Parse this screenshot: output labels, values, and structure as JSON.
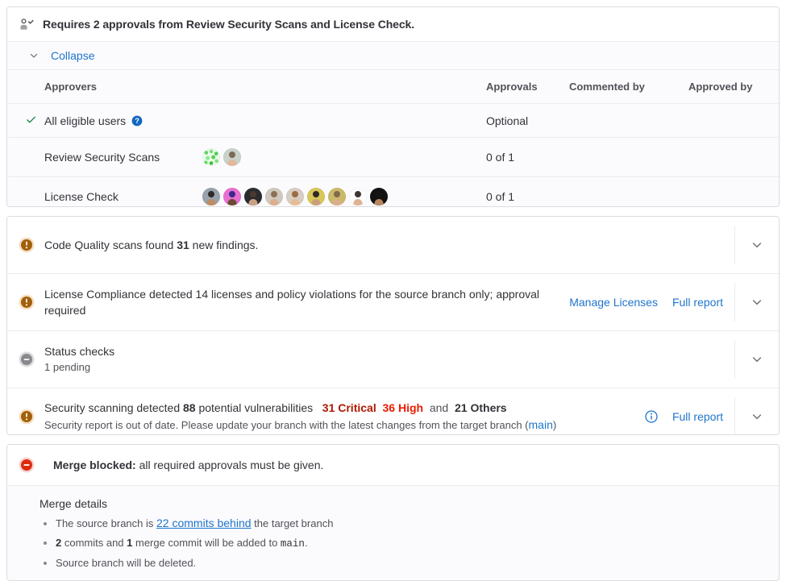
{
  "approvals": {
    "header_title": "Requires 2 approvals from Review Security Scans and License Check.",
    "header_icon": "approval-user-check-icon",
    "collapse_label": "Collapse",
    "columns": {
      "approvers": "Approvers",
      "approvals": "Approvals",
      "commented_by": "Commented by",
      "approved_by": "Approved by"
    },
    "rows": [
      {
        "name": "All eligible users",
        "has_check": true,
        "has_help": true,
        "approvals": "Optional",
        "commented_by": "",
        "approved_by": "",
        "avatars": []
      },
      {
        "name": "Review Security Scans",
        "has_check": false,
        "has_help": false,
        "approvals": "0 of 1",
        "commented_by": "",
        "approved_by": "",
        "avatars": [
          {
            "type": "identicon",
            "bg": "#ecfbec",
            "skin": "#8fd18f",
            "hair": "#4ec24e"
          },
          {
            "type": "photo",
            "bg": "#c8d2cb",
            "skin": "#e3b79a",
            "hair": "#7d6a53"
          }
        ]
      },
      {
        "name": "License Check",
        "has_check": false,
        "has_help": false,
        "approvals": "0 of 1",
        "commented_by": "",
        "approved_by": "",
        "avatars": [
          {
            "type": "photo",
            "bg": "#97a3ad",
            "skin": "#c08c63",
            "hair": "#2f2a28"
          },
          {
            "type": "photo",
            "bg": "#e86fd0",
            "skin": "#6b4a33",
            "hair": "#3b2a8c"
          },
          {
            "type": "photo",
            "bg": "#2b2b2f",
            "skin": "#caa184",
            "hair": "#4a3a2e"
          },
          {
            "type": "photo",
            "bg": "#cfc9c0",
            "skin": "#dcae8b",
            "hair": "#8c7154"
          },
          {
            "type": "photo",
            "bg": "#d8cdc4",
            "skin": "#e9bb94",
            "hair": "#9b6b43"
          },
          {
            "type": "photo",
            "bg": "#d8c758",
            "skin": "#caa07c",
            "hair": "#2e2b27"
          },
          {
            "type": "photo",
            "bg": "#cbb96a",
            "skin": "#dcae8b",
            "hair": "#7f6a4c"
          },
          {
            "type": "photo",
            "bg": "#fdfdfd",
            "skin": "#dfb392",
            "hair": "#3c3733"
          },
          {
            "type": "photo",
            "bg": "#121212",
            "skin": "#b8865f",
            "hair": "#171513"
          }
        ]
      }
    ]
  },
  "reports": [
    {
      "icon": "warning-icon",
      "icon_color": "#a35f0a",
      "text_before": "Code Quality scans found ",
      "text_bold": "31",
      "text_after": " new findings.",
      "subtext": "",
      "links": [],
      "toggle_icon": "chevron-down-icon"
    },
    {
      "icon": "warning-icon",
      "icon_color": "#a35f0a",
      "text_before": "License Compliance detected 14 licenses and policy violations for the source branch only; approval required",
      "text_bold": "",
      "text_after": "",
      "subtext": "",
      "links": [
        "Manage Licenses",
        "Full report"
      ],
      "toggle_icon": "chevron-down-icon"
    },
    {
      "icon": "pending-icon",
      "icon_color": "#89888d",
      "text_before": "Status checks",
      "text_bold": "",
      "text_after": "",
      "subtext": "1 pending",
      "links": [],
      "toggle_icon": "chevron-down-icon"
    },
    {
      "icon": "warning-icon",
      "icon_color": "#a35f0a",
      "text_before": "Security scanning detected ",
      "text_bold": "88",
      "text_after": " potential vulnerabilities",
      "severity_critical": "31 Critical",
      "severity_high": "36 High",
      "severity_and": "and",
      "severity_others": "21 Others",
      "subtext_before": "Security report is out of date. Please update your branch with the latest changes from the target branch (",
      "subtext_link": "main",
      "subtext_after": ")",
      "links": [
        "Full report"
      ],
      "info_icon": "info-circle-icon",
      "toggle_icon": "chevron-down-icon"
    }
  ],
  "merge_blocked": {
    "icon": "merge-blocked-icon",
    "title_bold": "Merge blocked:",
    "title_rest": " all required approvals must be given.",
    "details_title": "Merge details",
    "details": [
      {
        "before": "The source branch is ",
        "link": "22 commits behind",
        "after": " the target branch"
      },
      {
        "bold1": "2",
        "mid1": " commits and ",
        "bold2": "1",
        "mid2": " merge commit will be added to ",
        "code": "main",
        "tail": "."
      },
      {
        "plain": "Source branch will be deleted."
      }
    ]
  },
  "colors": {
    "link": "#1f75cb",
    "warning": "#a35f0a",
    "danger": "#dd2b0e",
    "critical": "#ae1800",
    "high": "#ec1b00",
    "pending": "#89888d",
    "check": "#108548"
  }
}
